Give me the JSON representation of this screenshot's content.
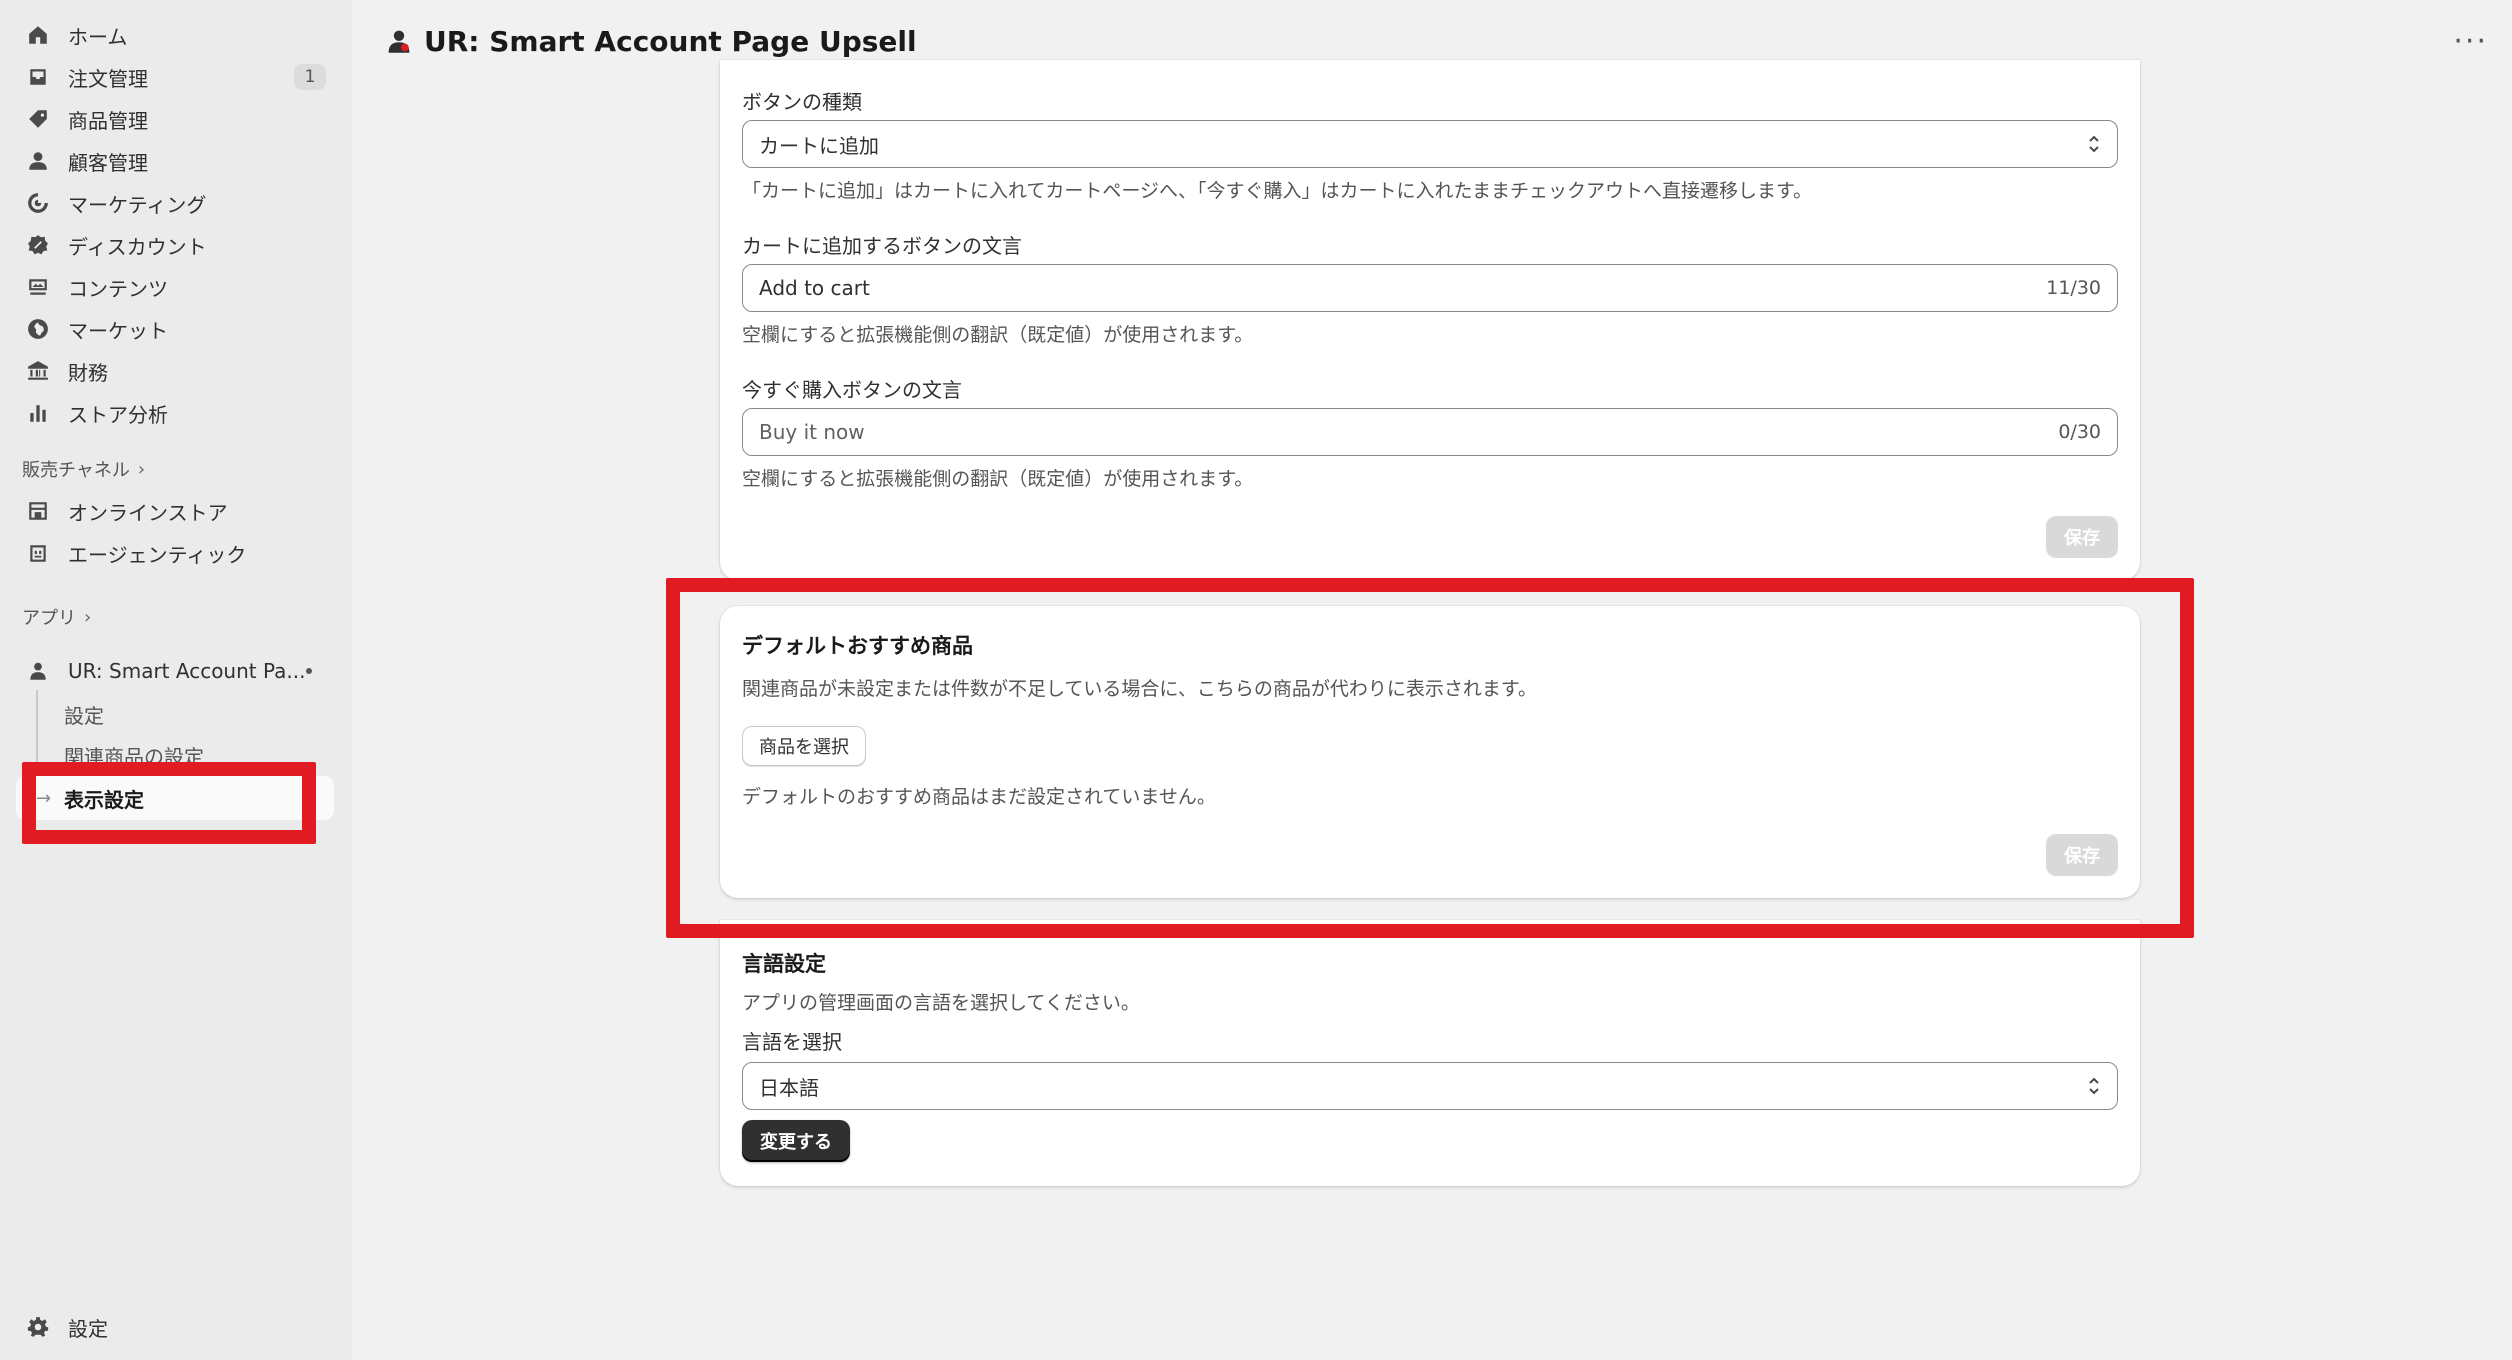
{
  "sidebar": {
    "items": [
      {
        "label": "ホーム",
        "icon": "home-icon"
      },
      {
        "label": "注文管理",
        "icon": "inbox-icon",
        "badge": "1"
      },
      {
        "label": "商品管理",
        "icon": "tag-icon"
      },
      {
        "label": "顧客管理",
        "icon": "person-icon"
      },
      {
        "label": "マーケティング",
        "icon": "target-icon"
      },
      {
        "label": "ディスカウント",
        "icon": "discount-icon"
      },
      {
        "label": "コンテンツ",
        "icon": "content-icon"
      },
      {
        "label": "マーケット",
        "icon": "globe-icon"
      },
      {
        "label": "財務",
        "icon": "bank-icon"
      },
      {
        "label": "ストア分析",
        "icon": "bar-chart-icon"
      }
    ],
    "sales_channels_label": "販売チャネル",
    "channels": [
      {
        "label": "オンラインストア",
        "icon": "store-icon"
      },
      {
        "label": "エージェンティック",
        "icon": "agent-icon"
      }
    ],
    "apps_label": "アプリ",
    "app": {
      "label": "UR: Smart Account Pa...",
      "icon": "person-app-icon"
    },
    "app_sub_items": [
      "設定",
      "関連商品の設定"
    ],
    "app_active_item": "表示設定",
    "settings_label": "設定"
  },
  "topbar": {
    "title": "UR: Smart Account Page Upsell",
    "more": "···"
  },
  "button_card": {
    "type_label": "ボタンの種類",
    "type_value": "カートに追加",
    "type_help": "「カートに追加」はカートに入れてカートページへ、「今すぐ購入」はカートに入れたままチェックアウトへ直接遷移します。",
    "atc_label": "カートに追加するボタンの文言",
    "atc_value": "Add to cart",
    "atc_counter": "11/30",
    "atc_help": "空欄にすると拡張機能側の翻訳（既定値）が使用されます。",
    "buy_label": "今すぐ購入ボタンの文言",
    "buy_placeholder": "Buy it now",
    "buy_counter": "0/30",
    "buy_help": "空欄にすると拡張機能側の翻訳（既定値）が使用されます。",
    "save_label": "保存"
  },
  "default_card": {
    "title": "デフォルトおすすめ商品",
    "description": "関連商品が未設定または件数が不足している場合に、こちらの商品が代わりに表示されます。",
    "select_button": "商品を選択",
    "empty_text": "デフォルトのおすすめ商品はまだ設定されていません。",
    "save_label": "保存"
  },
  "language_card": {
    "title": "言語設定",
    "description": "アプリの管理画面の言語を選択してください。",
    "select_label": "言語を選択",
    "select_value": "日本語",
    "change_button": "変更する"
  },
  "colors": {
    "highlight": "#e11b22",
    "primary_button": "#303030",
    "sidebar_bg": "#ebebeb",
    "page_bg": "#f1f1f1"
  }
}
